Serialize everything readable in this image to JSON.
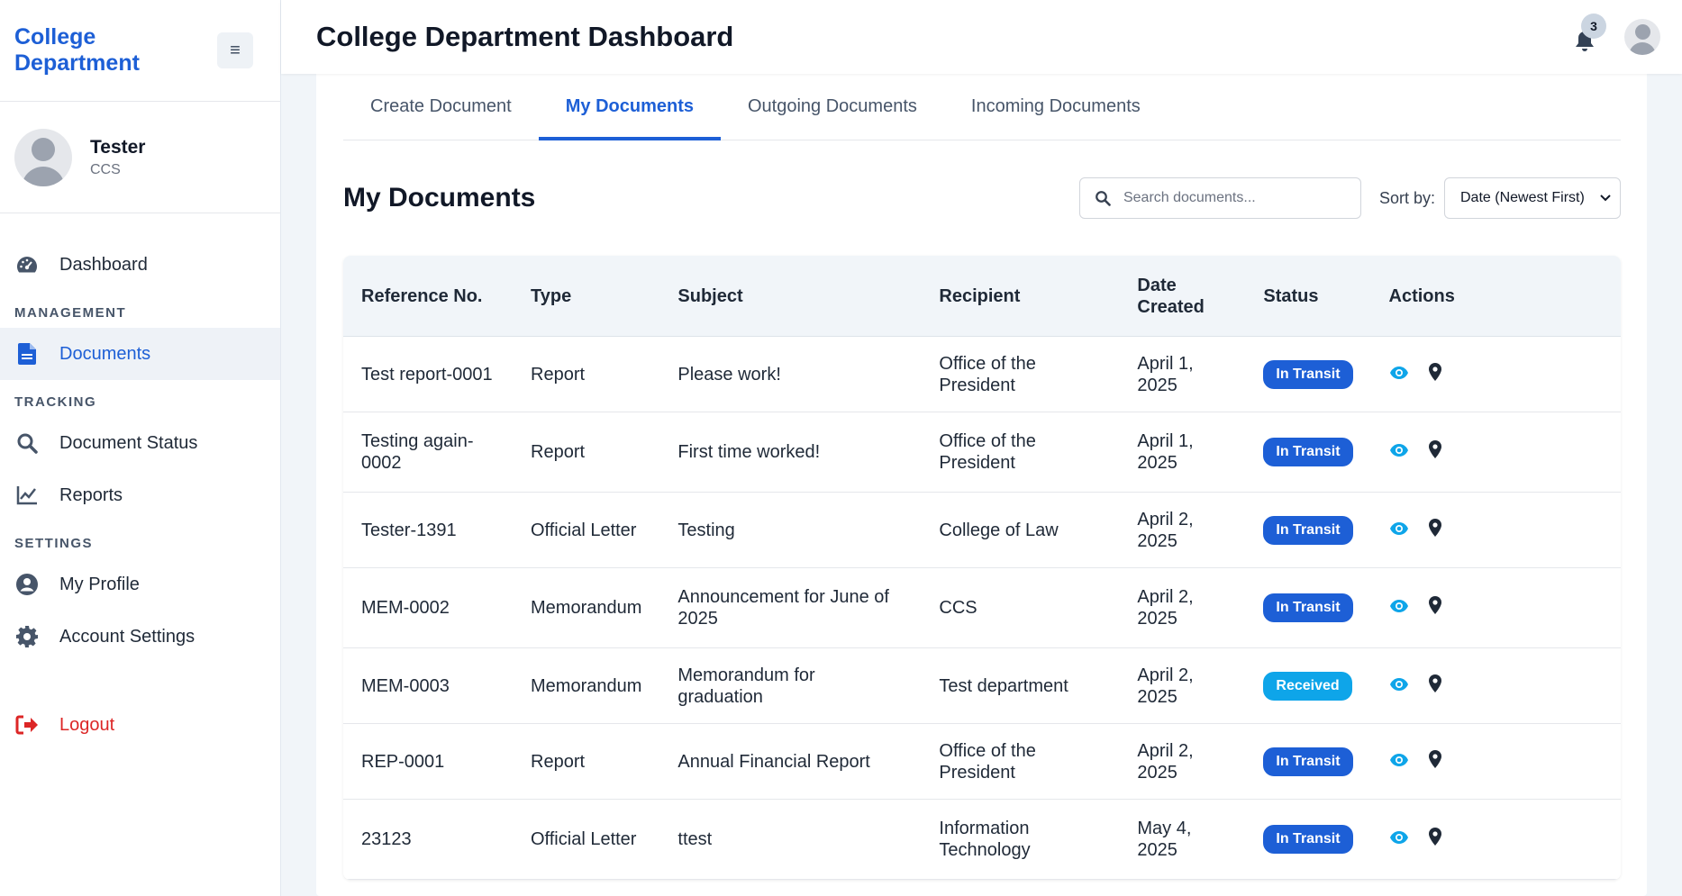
{
  "brand": {
    "title": "College Department"
  },
  "user": {
    "name": "Tester",
    "department": "CCS"
  },
  "nav": {
    "dashboard": "Dashboard",
    "section_management": "MANAGEMENT",
    "documents": "Documents",
    "section_tracking": "TRACKING",
    "document_status": "Document Status",
    "reports": "Reports",
    "section_settings": "SETTINGS",
    "my_profile": "My Profile",
    "account_settings": "Account Settings",
    "logout": "Logout"
  },
  "header": {
    "title": "College Department Dashboard",
    "notification_count": "3"
  },
  "tabs": [
    "Create Document",
    "My Documents",
    "Outgoing Documents",
    "Incoming Documents"
  ],
  "active_tab": 1,
  "section": {
    "title": "My Documents"
  },
  "search": {
    "placeholder": "Search documents..."
  },
  "sort": {
    "label": "Sort by:",
    "selected": "Date (Newest First)"
  },
  "table": {
    "headers": [
      "Reference No.",
      "Type",
      "Subject",
      "Recipient",
      "Date Created",
      "Status",
      "Actions"
    ],
    "rows": [
      {
        "ref": "Test report-0001",
        "type": "Report",
        "subject": "Please work!",
        "recipient": "Office of the President",
        "date": "April 1, 2025",
        "status": "In Transit"
      },
      {
        "ref": "Testing again-0002",
        "type": "Report",
        "subject": "First time worked!",
        "recipient": "Office of the President",
        "date": "April 1, 2025",
        "status": "In Transit"
      },
      {
        "ref": "Tester-1391",
        "type": "Official Letter",
        "subject": "Testing",
        "recipient": "College of Law",
        "date": "April 2, 2025",
        "status": "In Transit"
      },
      {
        "ref": "MEM-0002",
        "type": "Memorandum",
        "subject": "Announcement for June of 2025",
        "recipient": "CCS",
        "date": "April 2, 2025",
        "status": "In Transit"
      },
      {
        "ref": "MEM-0003",
        "type": "Memorandum",
        "subject": "Memorandum for graduation",
        "recipient": "Test department",
        "date": "April 2, 2025",
        "status": "Received"
      },
      {
        "ref": "REP-0001",
        "type": "Report",
        "subject": "Annual Financial Report",
        "recipient": "Office of the President",
        "date": "April 2, 2025",
        "status": "In Transit"
      },
      {
        "ref": "23123",
        "type": "Official Letter",
        "subject": "ttest",
        "recipient": "Information Technology",
        "date": "May 4, 2025",
        "status": "In Transit"
      }
    ]
  },
  "colors": {
    "accent": "#1d5fd6",
    "status_in_transit": "#1d5fd6",
    "status_received": "#0ea5e9",
    "view_icon": "#0ea5e9",
    "logout": "#dc2626"
  },
  "icons": {
    "menu_toggle": "hamburger-icon",
    "dashboard": "speedometer-icon",
    "documents": "file-icon",
    "document_status": "search-icon",
    "reports": "line-chart-icon",
    "my_profile": "user-circle-icon",
    "account_settings": "gear-icon",
    "logout": "sign-out-icon",
    "notifications": "bell-icon",
    "row_view": "eye-icon",
    "row_track": "map-marker-icon"
  }
}
